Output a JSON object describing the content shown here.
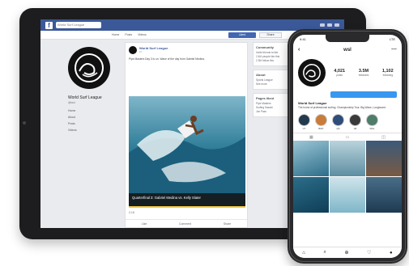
{
  "facebook": {
    "search_placeholder": "World Surf League",
    "tabs": [
      "Home",
      "Posts",
      "Videos"
    ],
    "like_button": "Liked",
    "more_button": "Share",
    "page_name": "World Surf League",
    "page_handle": "@wsl",
    "menu": [
      "Home",
      "About",
      "Posts",
      "Videos"
    ],
    "post": {
      "author": "World Surf League",
      "time": "1h",
      "text": "Pipe Masters Day 3 is on. Wave of the day from Gabriel Medina.",
      "caption": "Quarterfinal 3: Gabriel Medina vs. Kelly Slater",
      "reactions": "2.1K",
      "actions": [
        "Like",
        "Comment",
        "Share"
      ]
    },
    "sidebar": [
      {
        "title": "Community",
        "lines": [
          "Invite friends to like",
          "2.4M people like this",
          "2.3M follow this"
        ]
      },
      {
        "title": "About",
        "lines": [
          "Sports League",
          "See more"
        ]
      },
      {
        "title": "Pages liked",
        "lines": [
          "Pipe Masters",
          "Surfing Hawaii",
          "Jon Pasc"
        ]
      }
    ]
  },
  "instagram": {
    "status_time": "9:41",
    "status_right": "LTE",
    "handle": "wsl",
    "back_icon": "chevron-left-icon",
    "stats": [
      {
        "n": "4,021",
        "l": "posts"
      },
      {
        "n": "3.5M",
        "l": "followers"
      },
      {
        "n": "1,102",
        "l": "following"
      }
    ],
    "profile_name": "World Surf League",
    "bio": "The home of professional surfing. Championship Tour, Big Wave, Longboard.",
    "highlights": [
      "CT",
      "BWT",
      "QS",
      "LB",
      "WSL"
    ]
  },
  "colors": {
    "fb_blue": "#3b5998",
    "ig_blue": "#3897f0",
    "caption_accent": "#f2c94c"
  }
}
